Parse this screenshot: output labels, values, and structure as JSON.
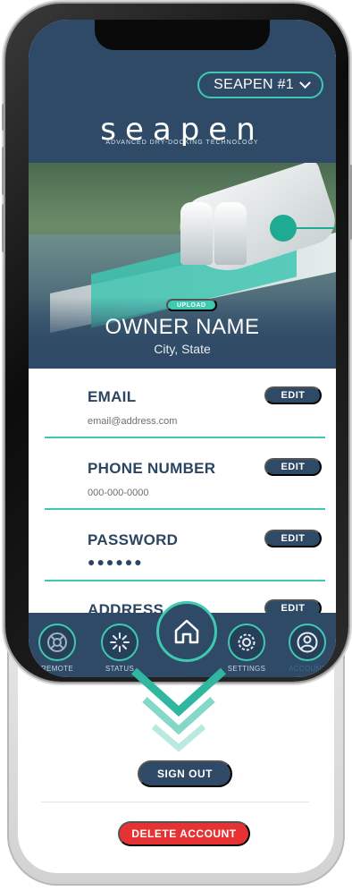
{
  "header": {
    "unit_selector": "SEAPEN #1",
    "logo_text": "seapen",
    "tagline": "ADVANCED DRY-DOCKING TECHNOLOGY"
  },
  "profile": {
    "upload_label": "UPLOAD",
    "owner_name": "OWNER NAME",
    "location": "City, State"
  },
  "fields": [
    {
      "label": "EMAIL",
      "value": "email@address.com",
      "edit": "EDIT"
    },
    {
      "label": "PHONE NUMBER",
      "value": "000-000-0000",
      "edit": "EDIT"
    },
    {
      "label": "PASSWORD",
      "value": "●●●●●●",
      "edit": "EDIT"
    },
    {
      "label": "ADDRESS",
      "value": "",
      "edit": "EDIT"
    }
  ],
  "nav": {
    "items": [
      {
        "label": "REMOTE",
        "icon": "remote-icon"
      },
      {
        "label": "STATUS",
        "icon": "status-icon"
      },
      {
        "label": "SETTINGS",
        "icon": "gear-icon"
      },
      {
        "label": "ACCOUNT",
        "icon": "user-icon"
      }
    ],
    "home_icon": "home-icon",
    "active": "ACCOUNT"
  },
  "footer": {
    "sign_out": "SIGN OUT",
    "delete_account": "DELETE ACCOUNT"
  },
  "colors": {
    "primary": "#2f4a66",
    "accent": "#3ec9b0",
    "danger": "#e63232"
  }
}
